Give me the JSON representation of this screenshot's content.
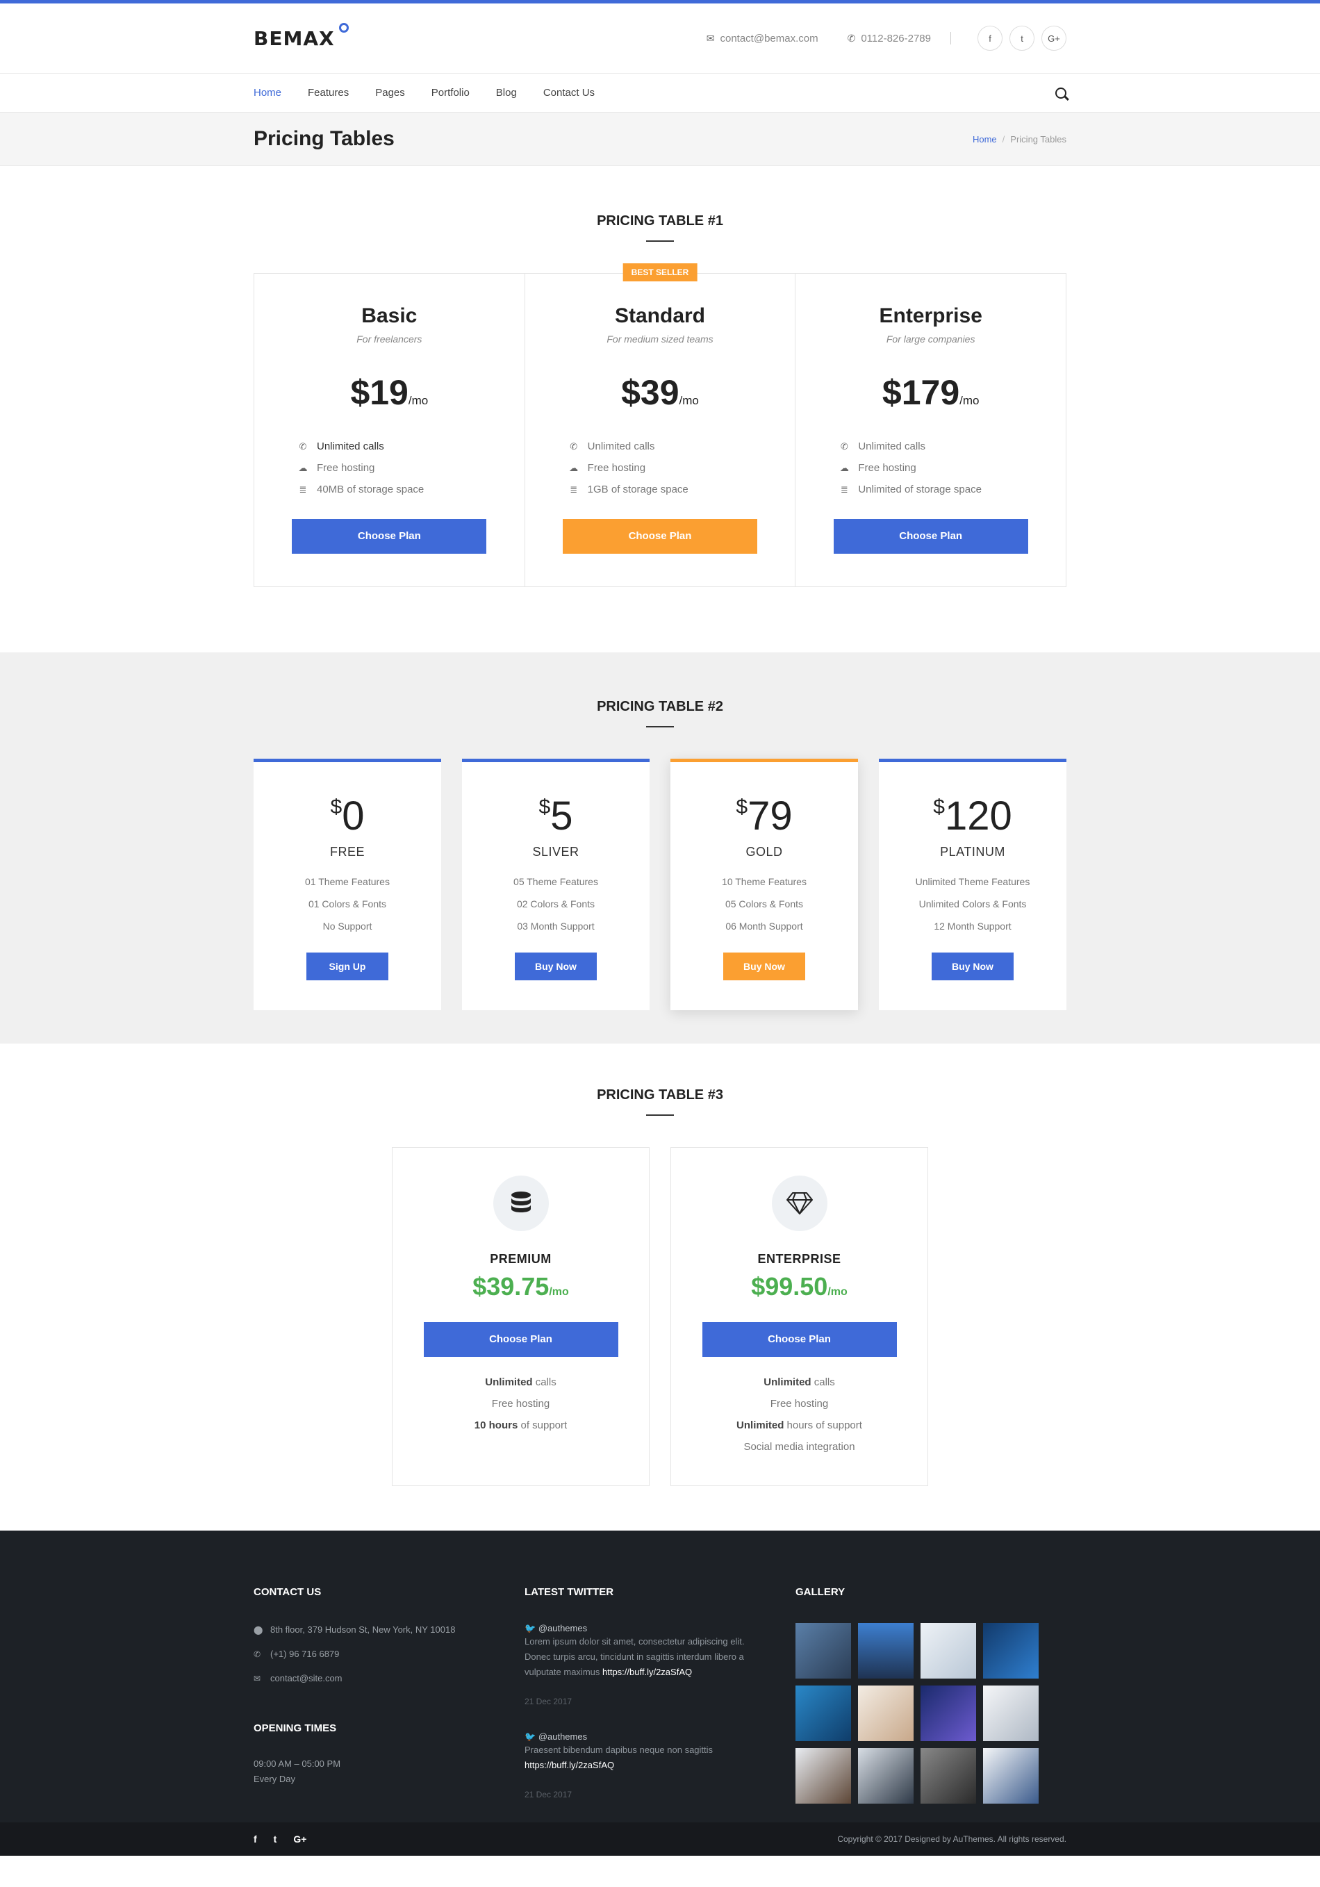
{
  "brand": {
    "logo": "BEMAX",
    "accent": "#3f6ad8",
    "orange": "#fb9f31",
    "green": "#4caf50"
  },
  "header": {
    "email": "contact@bemax.com",
    "phone": "0112-826-2789",
    "social": [
      "f",
      "t",
      "G+"
    ]
  },
  "nav": {
    "items": [
      "Home",
      "Features",
      "Pages",
      "Portfolio",
      "Blog",
      "Contact Us"
    ],
    "active": "Home"
  },
  "titlebar": {
    "title": "Pricing Tables",
    "breadcrumb_home": "Home",
    "breadcrumb_current": "Pricing Tables"
  },
  "pt1": {
    "title": "PRICING TABLE #1",
    "badge": "BEST SELLER",
    "plans": [
      {
        "name": "Basic",
        "sub": "For freelancers",
        "price": "$19",
        "unit": "/mo",
        "features": [
          "Unlimited calls",
          "Free hosting",
          "40MB of storage space"
        ],
        "button": "Choose Plan"
      },
      {
        "name": "Standard",
        "sub": "For medium sized teams",
        "price": "$39",
        "unit": "/mo",
        "features": [
          "Unlimited calls",
          "Free hosting",
          "1GB of storage space"
        ],
        "button": "Choose Plan"
      },
      {
        "name": "Enterprise",
        "sub": "For large companies",
        "price": "$179",
        "unit": "/mo",
        "features": [
          "Unlimited calls",
          "Free hosting",
          "Unlimited of storage space"
        ],
        "button": "Choose Plan"
      }
    ]
  },
  "pt2": {
    "title": "PRICING TABLE #2",
    "plans": [
      {
        "currency": "$",
        "amount": "0",
        "tier": "FREE",
        "features": [
          "01 Theme Features",
          "01 Colors & Fonts",
          "No Support"
        ],
        "button": "Sign Up"
      },
      {
        "currency": "$",
        "amount": "5",
        "tier": "SLIVER",
        "features": [
          "05 Theme Features",
          "02 Colors & Fonts",
          "03 Month Support"
        ],
        "button": "Buy Now"
      },
      {
        "currency": "$",
        "amount": "79",
        "tier": "GOLD",
        "features": [
          "10 Theme Features",
          "05 Colors & Fonts",
          "06 Month Support"
        ],
        "button": "Buy Now"
      },
      {
        "currency": "$",
        "amount": "120",
        "tier": "PLATINUM",
        "features": [
          "Unlimited Theme Features",
          "Unlimited Colors & Fonts",
          "12 Month Support"
        ],
        "button": "Buy Now"
      }
    ]
  },
  "pt3": {
    "title": "PRICING TABLE #3",
    "plans": [
      {
        "name": "PREMIUM",
        "price": "$39.75",
        "unit": "/mo",
        "button": "Choose Plan",
        "features": [
          {
            "b": "Unlimited",
            "t": " calls"
          },
          {
            "b": "",
            "t": "Free hosting"
          },
          {
            "b": "10 hours",
            "t": " of support"
          }
        ]
      },
      {
        "name": "ENTERPRISE",
        "price": "$99.50",
        "unit": "/mo",
        "button": "Choose Plan",
        "features": [
          {
            "b": "Unlimited",
            "t": " calls"
          },
          {
            "b": "",
            "t": "Free hosting"
          },
          {
            "b": "Unlimited",
            "t": " hours of support"
          },
          {
            "b": "",
            "t": "Social media integration"
          }
        ]
      }
    ]
  },
  "footer": {
    "contact_title": "CONTACT US",
    "address": "8th floor, 379 Hudson St, New York, NY 10018",
    "phone": "(+1) 96 716 6879",
    "email": "contact@site.com",
    "opening_title": "OPENING TIMES",
    "hours": "09:00 AM – 05:00 PM",
    "days": "Every Day",
    "twitter_title": "LATEST TWITTER",
    "tweets": [
      {
        "handle": "@authemes",
        "text": "Lorem ipsum dolor sit amet, consectetur adipiscing elit. Donec turpis arcu, tincidunt in sagittis interdum libero a vulputate maximus ",
        "link": "https://buff.ly/2zaSfAQ",
        "date": "21 Dec 2017"
      },
      {
        "handle": "@authemes",
        "text": "Praesent bibendum dapibus neque non sagittis ",
        "link": "https://buff.ly/2zaSfAQ",
        "date": "21 Dec 2017"
      }
    ],
    "gallery_title": "GALLERY",
    "copyright": "Copyright © 2017 Designed by AuThemes. All rights reserved.",
    "social": [
      "f",
      "t",
      "G+"
    ]
  }
}
